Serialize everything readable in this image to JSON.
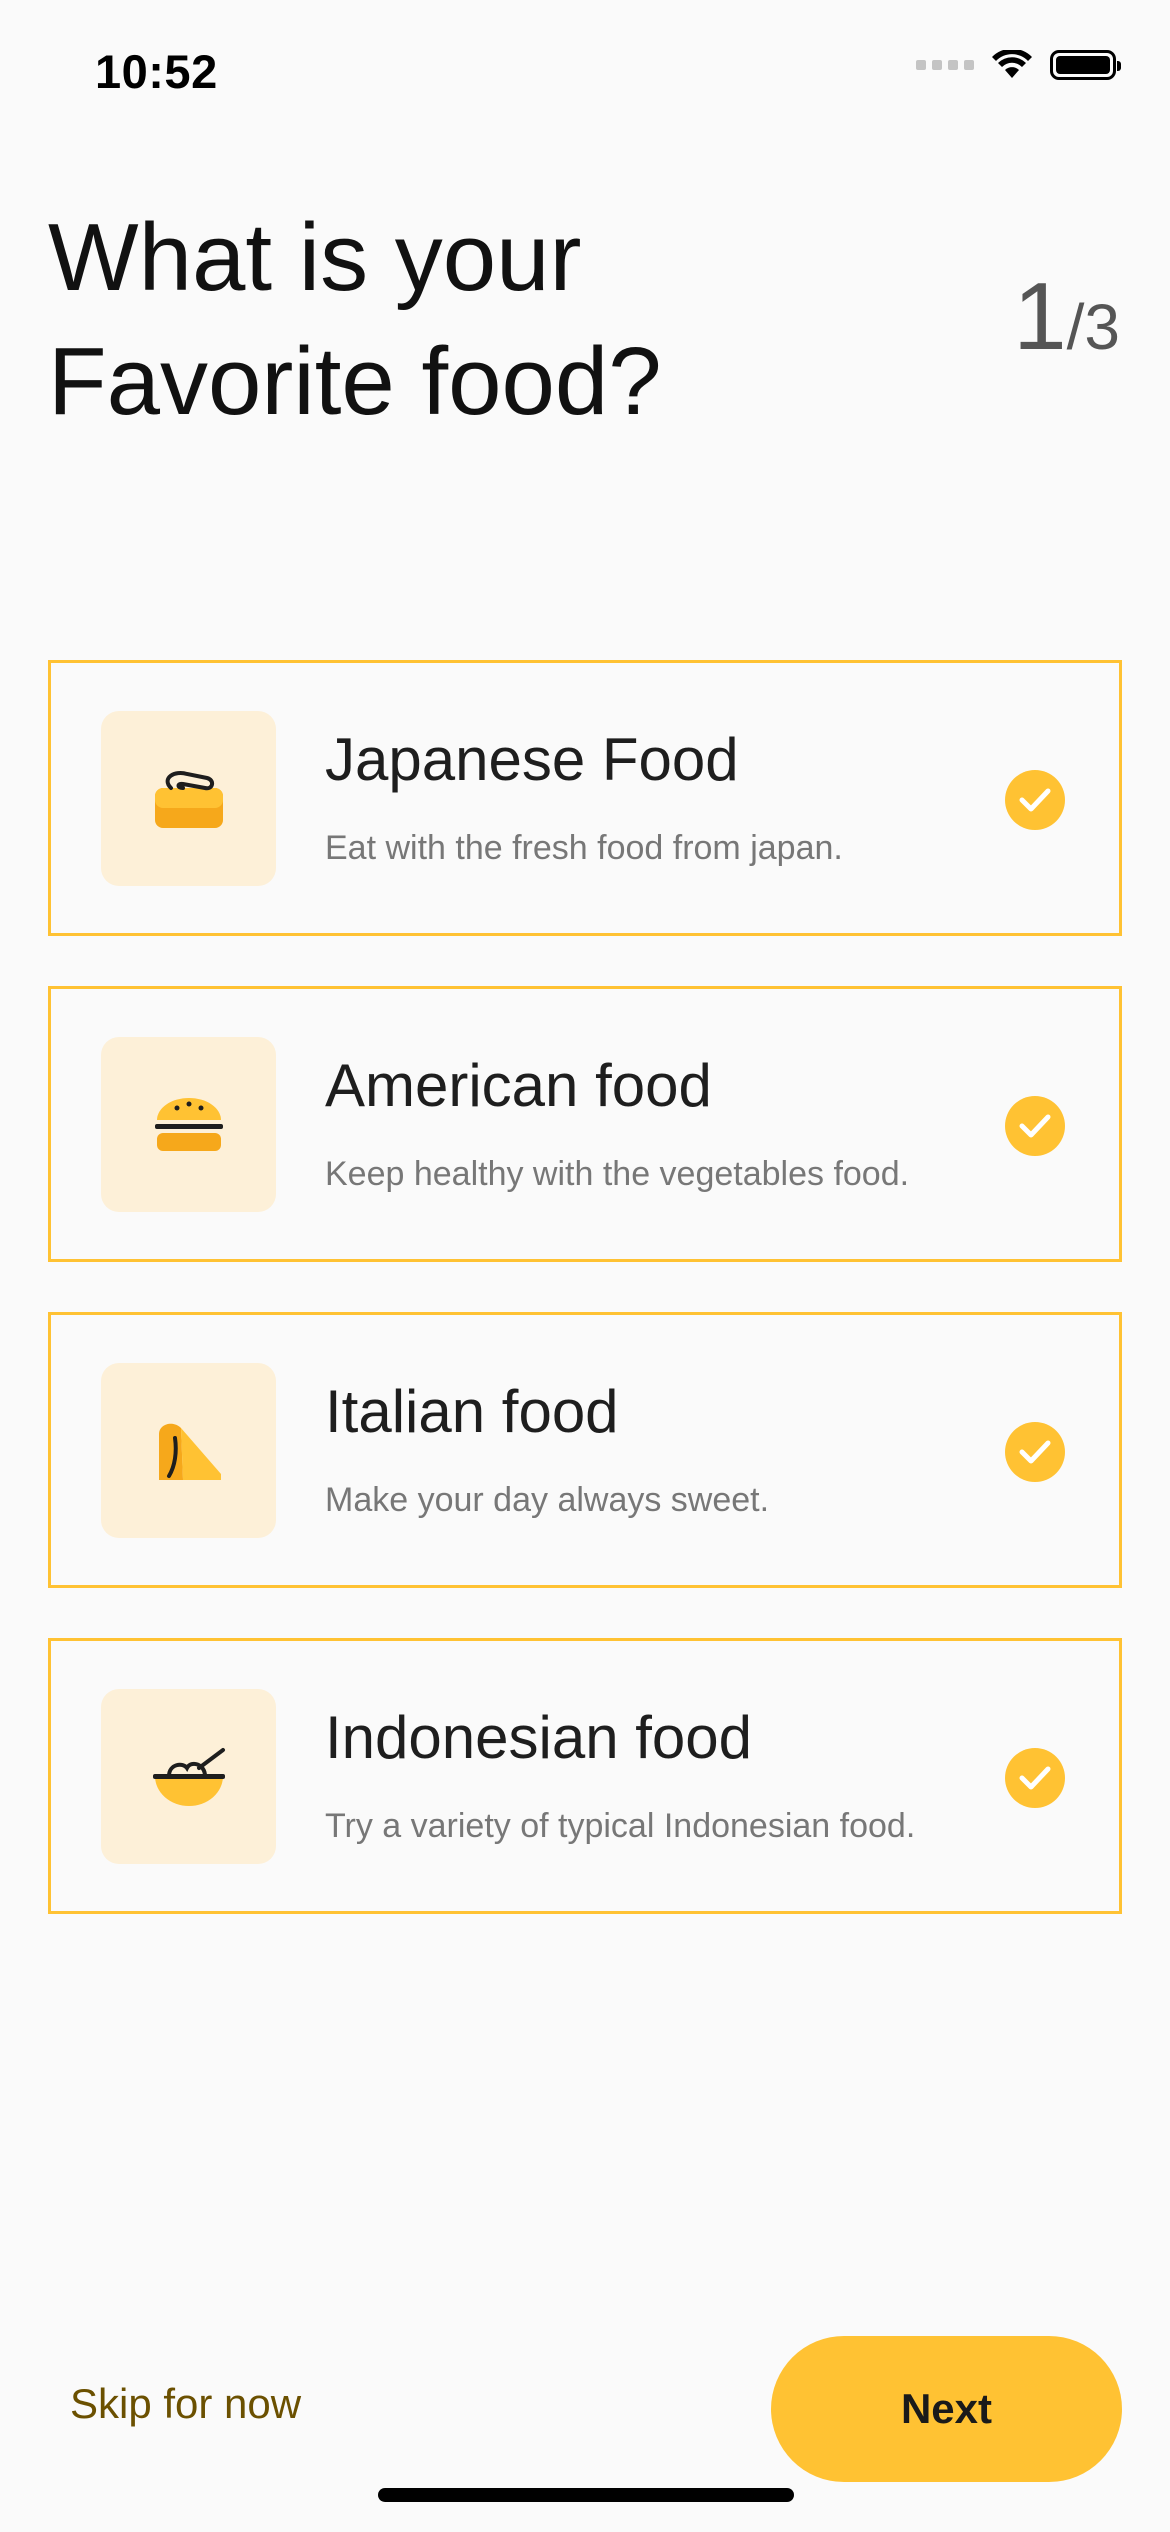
{
  "status_bar": {
    "time": "10:52"
  },
  "header": {
    "title_line1": "What is your",
    "title_line2": "Favorite food?",
    "step_current": "1",
    "step_separator": "/",
    "step_total": "3"
  },
  "options": [
    {
      "icon": "sushi-icon",
      "title": "Japanese Food",
      "description": "Eat with the fresh food from japan.",
      "selected": true
    },
    {
      "icon": "burger-icon",
      "title": "American food",
      "description": "Keep healthy with the vegetables food.",
      "selected": true
    },
    {
      "icon": "pizza-icon",
      "title": "Italian food",
      "description": "Make your day always sweet.",
      "selected": true
    },
    {
      "icon": "rice-bowl-icon",
      "title": "Indonesian food",
      "description": "Try a variety of typical Indonesian food.",
      "selected": true
    }
  ],
  "footer": {
    "skip_label": "Skip for now",
    "next_label": "Next"
  },
  "colors": {
    "accent": "#ffc233",
    "icon_bg": "#fdf0d8",
    "skip_text": "#6b5000",
    "background": "#fafafa"
  }
}
